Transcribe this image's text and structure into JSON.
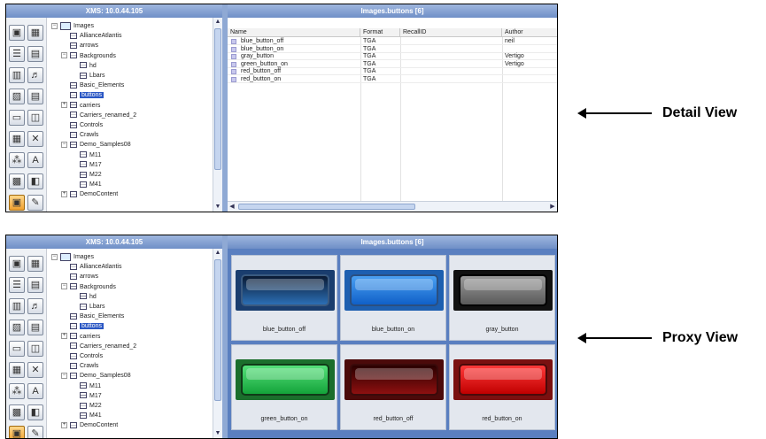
{
  "server_title": "XMS: 10.0.44.105",
  "panel_title": "Images.buttons [6]",
  "tree": [
    {
      "label": "Images",
      "level": 0,
      "expander": "−",
      "icon": "folder"
    },
    {
      "label": "AllianceAtlantis",
      "level": 1,
      "expander": "",
      "icon": "node"
    },
    {
      "label": "arrows",
      "level": 1,
      "expander": "",
      "icon": "node"
    },
    {
      "label": "Backgrounds",
      "level": 1,
      "expander": "−",
      "icon": "node"
    },
    {
      "label": "hd",
      "level": 2,
      "expander": "",
      "icon": "node"
    },
    {
      "label": "Lbars",
      "level": 2,
      "expander": "",
      "icon": "node"
    },
    {
      "label": "Basic_Elements",
      "level": 1,
      "expander": "",
      "icon": "node"
    },
    {
      "label": "buttons",
      "level": 1,
      "expander": "",
      "icon": "node",
      "selected": true
    },
    {
      "label": "carriers",
      "level": 1,
      "expander": "+",
      "icon": "node"
    },
    {
      "label": "Carriers_renamed_2",
      "level": 1,
      "expander": "",
      "icon": "node"
    },
    {
      "label": "Controls",
      "level": 1,
      "expander": "",
      "icon": "node"
    },
    {
      "label": "Crawls",
      "level": 1,
      "expander": "",
      "icon": "node"
    },
    {
      "label": "Demo_Samples08",
      "level": 1,
      "expander": "−",
      "icon": "node"
    },
    {
      "label": "M11",
      "level": 2,
      "expander": "",
      "icon": "node"
    },
    {
      "label": "M17",
      "level": 2,
      "expander": "",
      "icon": "node"
    },
    {
      "label": "M22",
      "level": 2,
      "expander": "",
      "icon": "node"
    },
    {
      "label": "M41",
      "level": 2,
      "expander": "",
      "icon": "node"
    },
    {
      "label": "DemoContent",
      "level": 1,
      "expander": "+",
      "icon": "node"
    }
  ],
  "toolbar_icons": [
    "save-icon",
    "grid-icon",
    "list-icon",
    "document-icon",
    "properties-icon",
    "music-icon",
    "image-icon",
    "page-icon",
    "screen-icon",
    "columns-icon",
    "template-icon",
    "delete-icon",
    "tree-icon",
    "font-icon",
    "keypad-icon",
    "frame-icon",
    "proxy-icon",
    "pencil-icon"
  ],
  "toolbar_glyphs": [
    "▣",
    "▦",
    "☰",
    "▤",
    "▥",
    "♬",
    "▨",
    "▤",
    "▭",
    "◫",
    "▦",
    "✕",
    "⁂",
    "A",
    "▩",
    "◧",
    "▣",
    "✎"
  ],
  "columns": [
    "Name",
    "Format",
    "RecallID",
    "Author"
  ],
  "rows": [
    {
      "name": "blue_button_off",
      "format": "TGA",
      "recall": "",
      "author": "neil"
    },
    {
      "name": "blue_button_on",
      "format": "TGA",
      "recall": "",
      "author": ""
    },
    {
      "name": "gray_button",
      "format": "TGA",
      "recall": "",
      "author": "Vertigo"
    },
    {
      "name": "green_button_on",
      "format": "TGA",
      "recall": "",
      "author": "Vertigo"
    },
    {
      "name": "red_button_off",
      "format": "TGA",
      "recall": "",
      "author": ""
    },
    {
      "name": "red_button_on",
      "format": "TGA",
      "recall": "",
      "author": ""
    }
  ],
  "proxies": [
    {
      "caption": "blue_button_off",
      "frame": "#1a3d6e",
      "top": "#0a1a33",
      "bottom": "#2c6fb5",
      "border": "#3a5a80"
    },
    {
      "caption": "blue_button_on",
      "frame": "#1d5fb0",
      "top": "#4aa0f2",
      "bottom": "#1060c8",
      "border": "#2a4f80"
    },
    {
      "caption": "gray_button",
      "frame": "#111111",
      "top": "#9a9a9a",
      "bottom": "#5a5a5a",
      "border": "#000000"
    },
    {
      "caption": "green_button_on",
      "frame": "#1b6e2c",
      "top": "#55e07a",
      "bottom": "#14a33a",
      "border": "#103a18"
    },
    {
      "caption": "red_button_off",
      "frame": "#4b0a0a",
      "top": "#2a0000",
      "bottom": "#8e1010",
      "border": "#3a0a0a"
    },
    {
      "caption": "red_button_on",
      "frame": "#7a1010",
      "top": "#ff3a3a",
      "bottom": "#c00000",
      "border": "#4a0a0a"
    }
  ],
  "annotations": {
    "detail": "Detail View",
    "proxy": "Proxy View"
  },
  "colors": {
    "selection": "#2a57c4",
    "titlebar": "#7b98cc",
    "proxy_background": "#5a7fc0"
  }
}
